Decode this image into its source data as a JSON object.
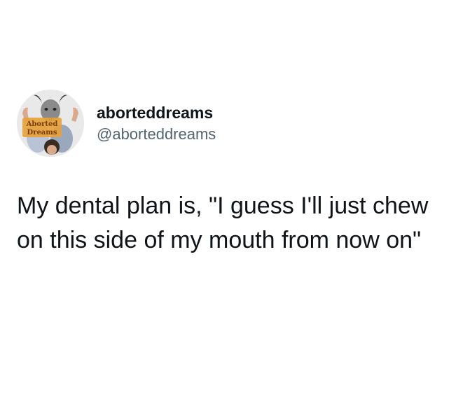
{
  "author": {
    "display_name": "aborteddreams",
    "handle": "@aborteddreams",
    "avatar_logo_text": [
      "Aborted",
      "Dreams"
    ]
  },
  "tweet": {
    "text": "My dental plan is, \"I guess I'll just chew on this side of my mouth from now on\""
  },
  "colors": {
    "background": "#ffffff",
    "text": "#0f1419",
    "handle": "#536471",
    "logo_fill": "#e6a23c"
  }
}
